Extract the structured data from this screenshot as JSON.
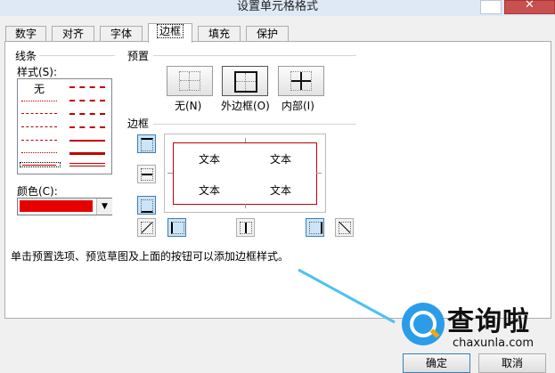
{
  "window": {
    "title": "设置单元格格式"
  },
  "tabs": [
    {
      "label": "数字"
    },
    {
      "label": "对齐"
    },
    {
      "label": "字体"
    },
    {
      "label": "边框"
    },
    {
      "label": "填充"
    },
    {
      "label": "保护"
    }
  ],
  "line": {
    "group_label": "线条",
    "style_label": "样式(S):",
    "none_label": "无",
    "color_label": "颜色(C):",
    "color_value": "#e60000"
  },
  "presets": {
    "group_label": "预置",
    "none": "无(N)",
    "outline": "外边框(O)",
    "inside": "内部(I)"
  },
  "border": {
    "group_label": "边框",
    "preview_texts": [
      "文本",
      "文本",
      "文本",
      "文本"
    ],
    "line_color": "#c00000"
  },
  "hint": "单击预置选项、预览草图及上面的按钮可以添加边框样式。",
  "watermark": {
    "brand": "查询啦",
    "url": "chaxunla.com"
  },
  "buttons": {
    "ok": "确定",
    "cancel": "取消"
  }
}
